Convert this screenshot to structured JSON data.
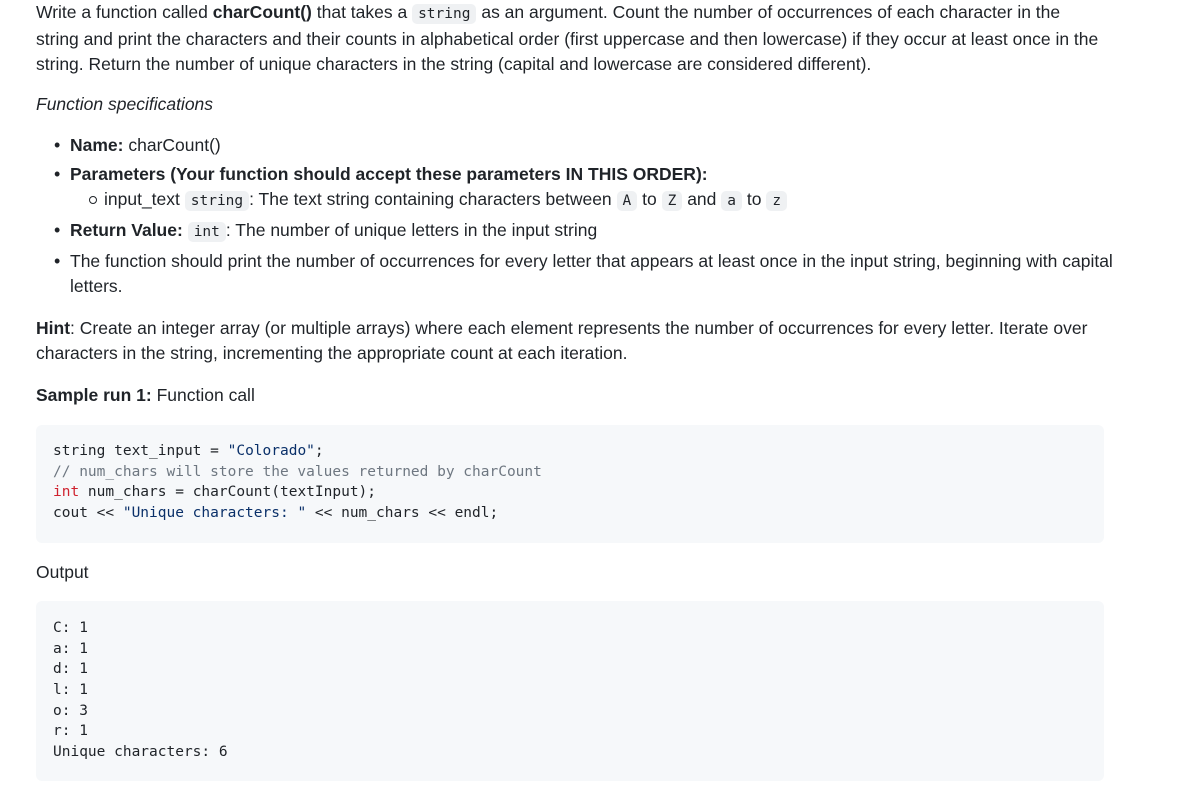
{
  "intro": {
    "part1": "Write a function called ",
    "fn_name": "charCount()",
    "part2": " that takes a ",
    "type_code": "string",
    "part3": " as an argument. Count the number of occurrences of each character in the string and print the characters and their counts in alphabetical order (first uppercase and then lowercase) if they occur at least once in the string. Return the number of unique characters in the string (capital and lowercase are considered different)."
  },
  "spec_heading": "Function specifications",
  "specs": {
    "name_label": "Name:",
    "name_value": " charCount()",
    "params_label": "Parameters (Your function should accept these parameters IN THIS ORDER):",
    "param": {
      "name": "input_text ",
      "type": "string",
      "desc1": ": The text string containing characters between ",
      "A": "A",
      "to1": " to ",
      "Z": "Z",
      "and": " and ",
      "a": "a",
      "to2": " to ",
      "z": "z"
    },
    "return_label": "Return Value:",
    "return_type": "int",
    "return_desc": ": The number of unique letters in the input string",
    "print_note": "The function should print the number of occurrences for every letter that appears at least once in the input string, beginning with capital letters."
  },
  "hint": {
    "label": "Hint",
    "text": ": Create an integer array (or multiple arrays) where each element represents the number of occurrences for every letter. Iterate over characters in the string, incrementing the appropriate count at each iteration."
  },
  "sample": {
    "label": "Sample run 1:",
    "text": " Function call"
  },
  "code_call": {
    "line1_a": "string text_input = ",
    "line1_str": "\"Colorado\"",
    "line1_b": ";",
    "line2_comment": "// num_chars will store the values returned by charCount",
    "line3_kw": "int",
    "line3_rest": " num_chars = charCount(textInput);",
    "line4_a": "cout << ",
    "line4_str": "\"Unique characters: \"",
    "line4_b": " << num_chars << endl;"
  },
  "output_label": "Output",
  "output_lines": [
    "C: 1",
    "a: 1",
    "d: 1",
    "l: 1",
    "o: 3",
    "r: 1",
    "Unique characters: 6"
  ]
}
